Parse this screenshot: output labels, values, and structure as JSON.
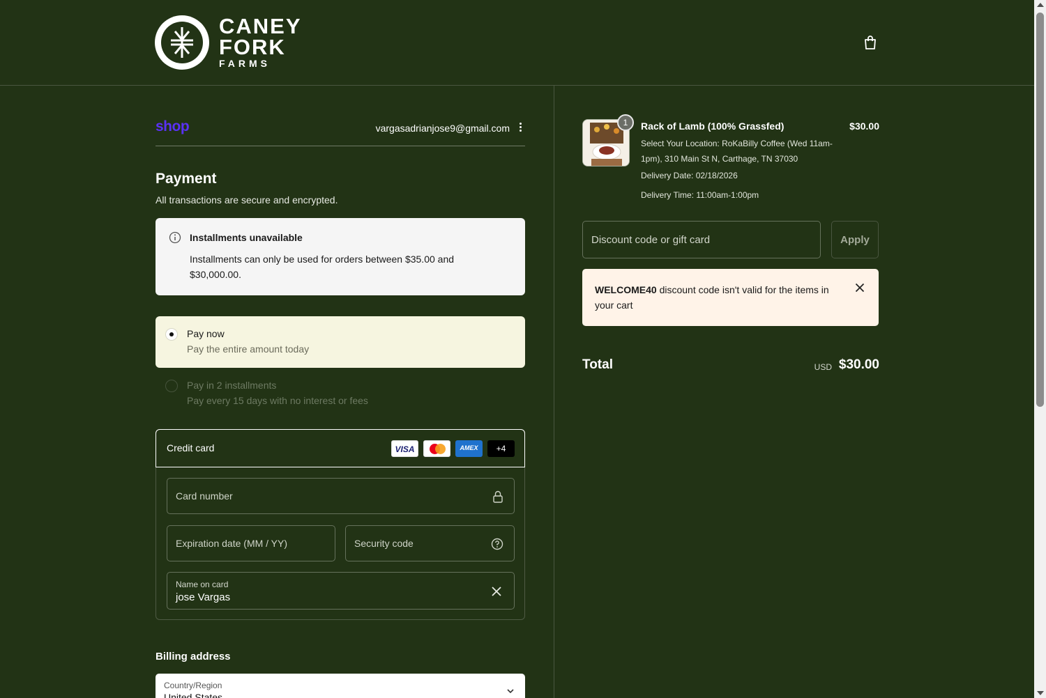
{
  "header": {
    "logo_line1": "CANEY",
    "logo_line2": "FORK",
    "logo_line3": "FARMS",
    "cart_icon": "shopping-bag-icon"
  },
  "account": {
    "shop_label": "shop",
    "email": "vargasadrianjose9@gmail.com",
    "menu_icon": "vertical-ellipsis-icon"
  },
  "payment": {
    "title": "Payment",
    "subtitle": "All transactions are secure and encrypted.",
    "installments_notice": {
      "title": "Installments unavailable",
      "body": "Installments can only be used for orders between $35.00 and $30,000.00."
    },
    "options": [
      {
        "title": "Pay now",
        "desc": "Pay the entire amount today",
        "selected": true
      },
      {
        "title": "Pay in 2 installments",
        "desc": "Pay every 15 days with no interest or fees",
        "selected": false
      }
    ],
    "credit_card": {
      "label": "Credit card",
      "brands": [
        "VISA",
        "Mastercard",
        "AMEX",
        "+4"
      ],
      "card_number_placeholder": "Card number",
      "expiration_placeholder": "Expiration date (MM / YY)",
      "security_placeholder": "Security code",
      "name_label": "Name on card",
      "name_value": "jose Vargas"
    }
  },
  "billing": {
    "title": "Billing address",
    "country_label": "Country/Region",
    "country_value": "United States"
  },
  "summary": {
    "item": {
      "quantity": "1",
      "title": "Rack of Lamb (100% Grassfed)",
      "price": "$30.00",
      "location": "Select Your Location: RoKaBilly Coffee (Wed 11am-1pm), 310 Main St N, Carthage, TN 37030",
      "delivery_date": "Delivery Date: 02/18/2026",
      "delivery_time": "Delivery Time: 11:00am-1:00pm"
    },
    "discount_placeholder": "Discount code or gift card",
    "apply_label": "Apply",
    "error": {
      "code": "WELCOME40",
      "message": " discount code isn't valid for the items in your cart"
    },
    "total_label": "Total",
    "currency": "USD",
    "total_value": "$30.00"
  },
  "colors": {
    "background": "#223315",
    "shop_purple": "#5a31f4",
    "selected_option_bg": "#f6f5e0",
    "error_bg": "#fff3e8"
  }
}
